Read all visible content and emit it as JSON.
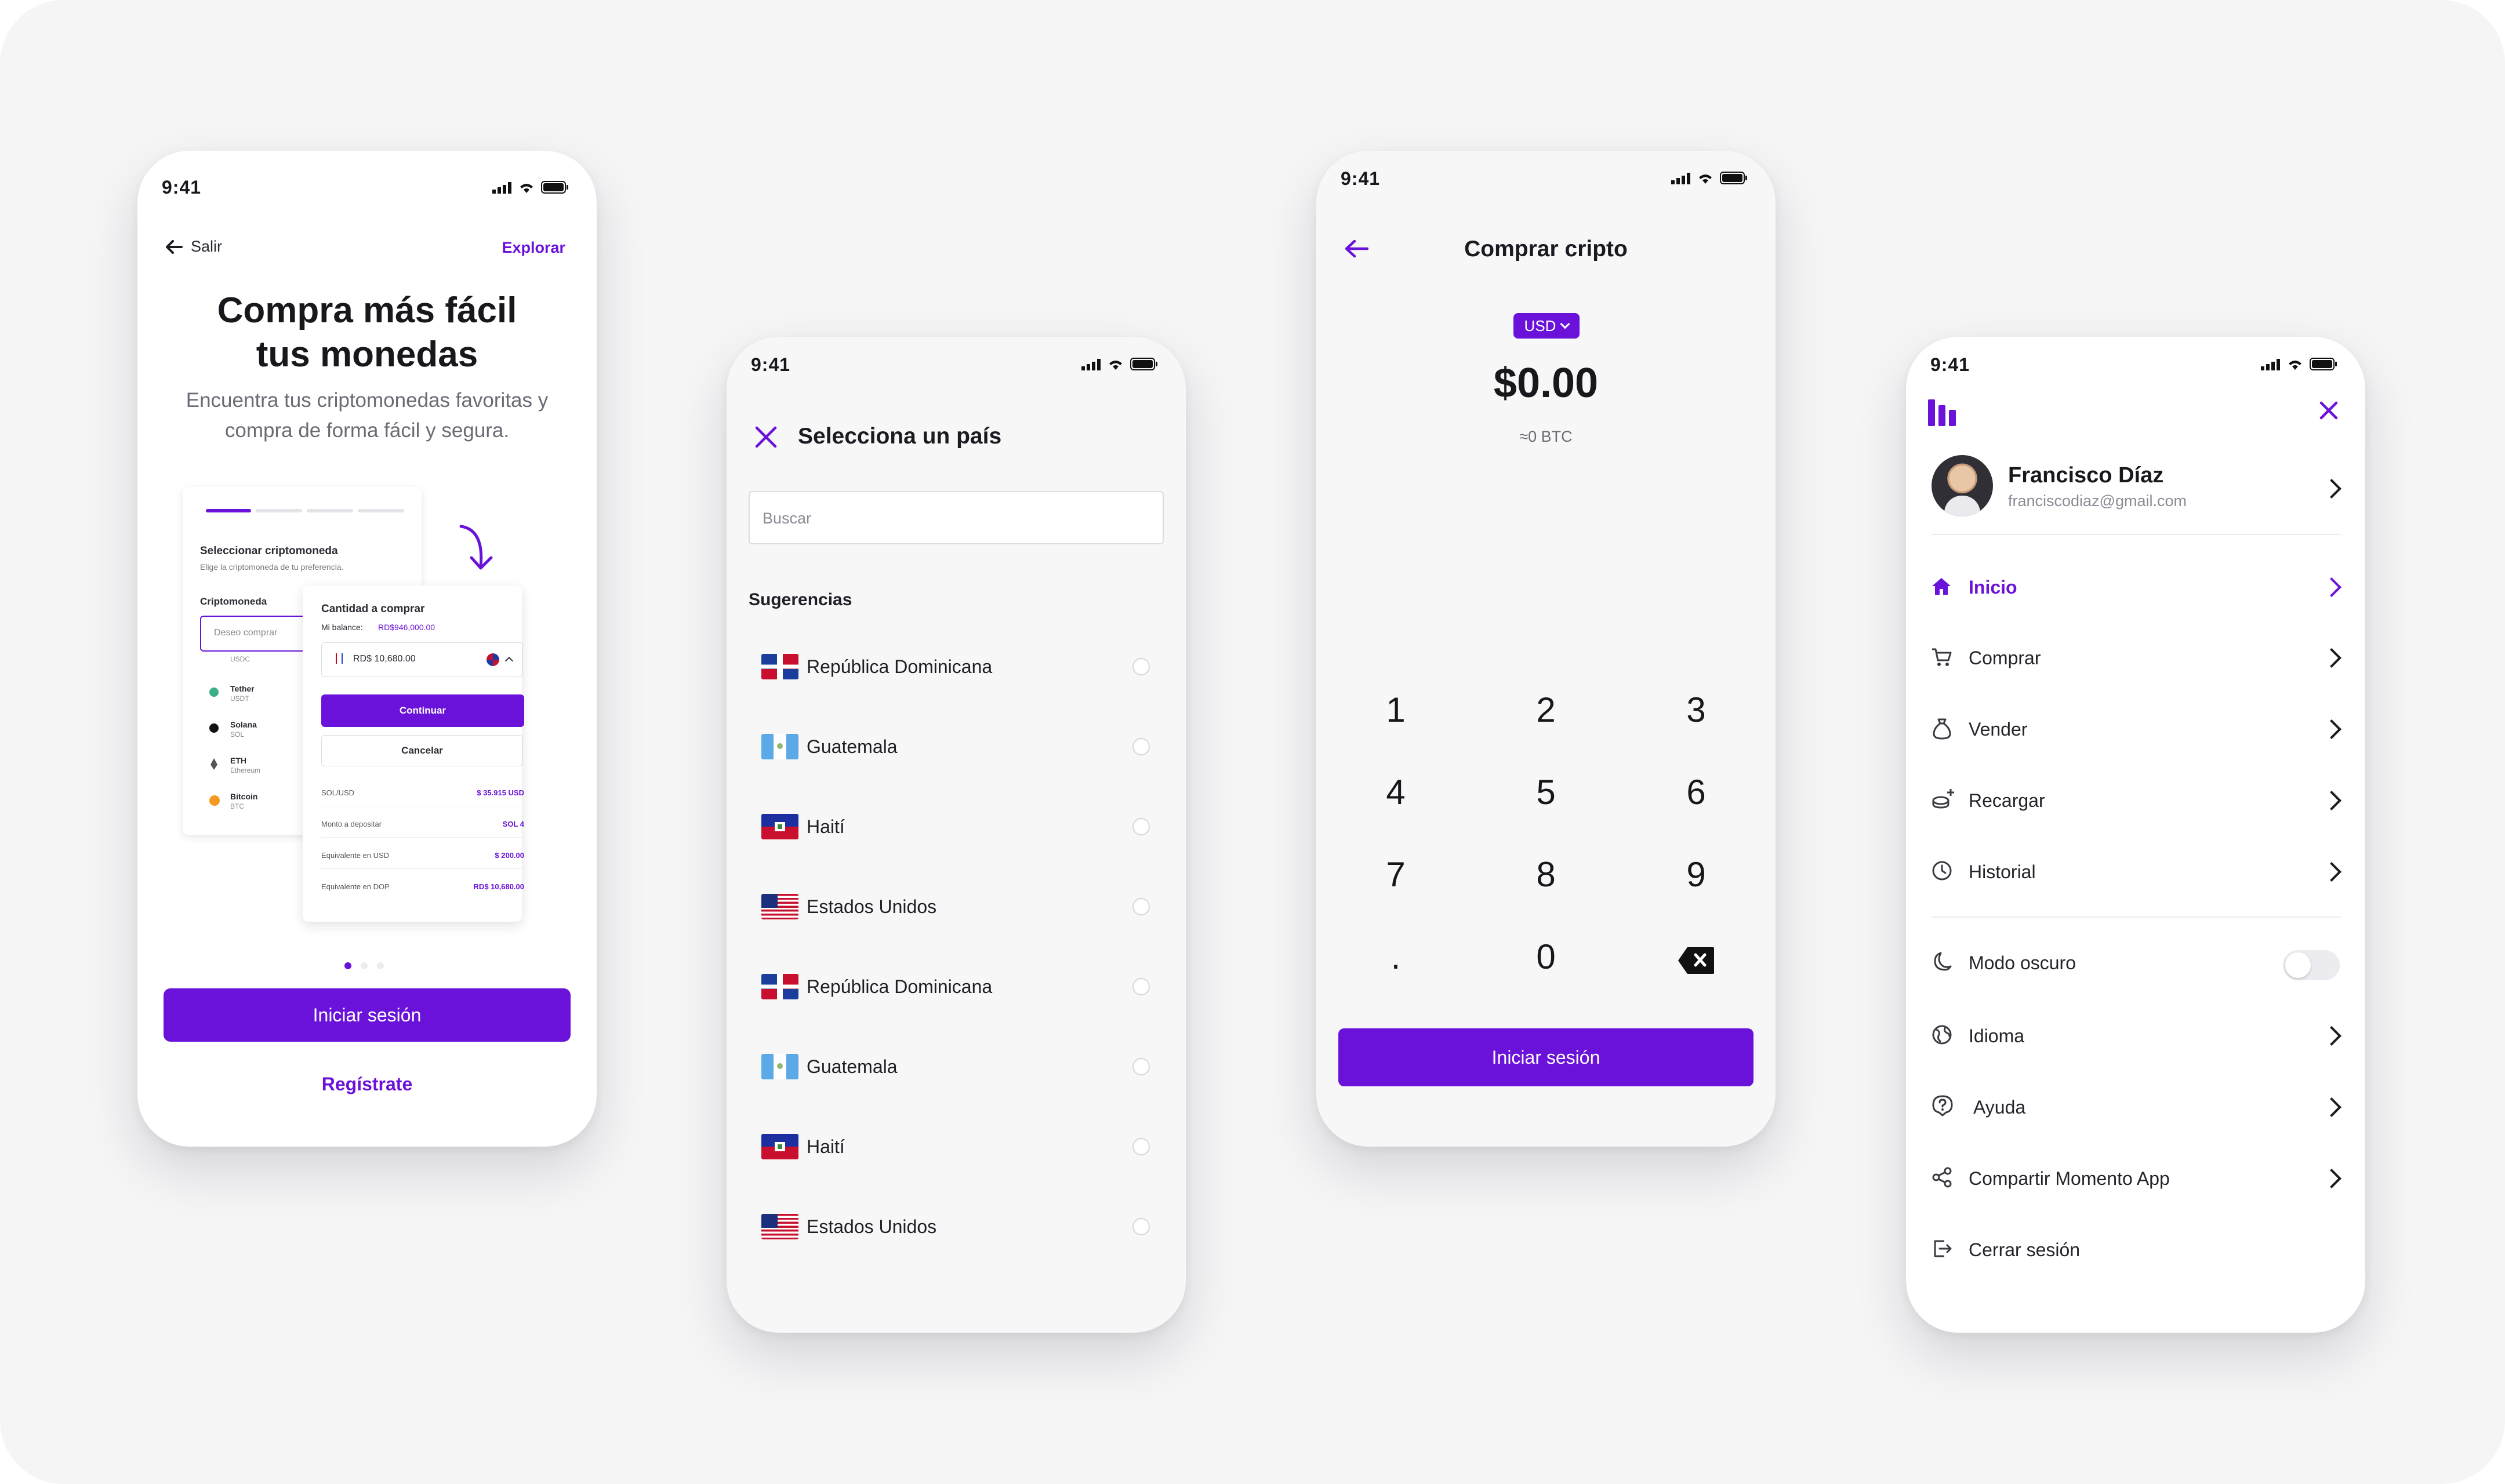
{
  "status_time": "9:41",
  "onboarding": {
    "back_label": "Salir",
    "explore_label": "Explorar",
    "headline_line1": "Compra más fácil",
    "headline_line2": "tus monedas",
    "subtitle_line1": "Encuentra tus criptomonedas favoritas y",
    "subtitle_line2": "compra de forma fácil y segura.",
    "login_button": "Iniciar sesión",
    "register_link": "Regístrate",
    "illustration": {
      "select_title": "Seleccionar criptomoneda",
      "select_subtitle": "Elige la criptomoneda de tu preferencia.",
      "crypto_label": "Criptomoneda",
      "crypto_placeholder": "Deseo comprar",
      "coins": [
        {
          "name": "",
          "ticker": "USDC"
        },
        {
          "name": "Tether",
          "ticker": "USDT"
        },
        {
          "name": "Solana",
          "ticker": "SOL"
        },
        {
          "name": "ETH",
          "ticker": "Ethereum"
        },
        {
          "name": "Bitcoin",
          "ticker": "BTC"
        }
      ],
      "amount_title": "Cantidad a comprar",
      "balance_label": "Mi balance:",
      "balance_value": "RD$946,000.00",
      "amount_value": "RD$ 10,680.00",
      "continue_button": "Continuar",
      "cancel_button": "Cancelar",
      "summary": [
        {
          "label": "SOL/USD",
          "value": "$ 35.915 USD"
        },
        {
          "label": "Monto a depositar",
          "value": "SOL 4"
        },
        {
          "label": "Equivalente en USD",
          "value": "$ 200.00"
        },
        {
          "label": "Equivalente en DOP",
          "value": "RD$ 10,680.00"
        }
      ]
    },
    "pagination": {
      "pages": 3,
      "active": 1
    }
  },
  "country_select": {
    "title": "Selecciona un país",
    "search_placeholder": "Buscar",
    "section_title": "Sugerencias",
    "countries": [
      {
        "name": "República Dominicana",
        "flag": "dominican-republic"
      },
      {
        "name": "Guatemala",
        "flag": "guatemala"
      },
      {
        "name": "Haití",
        "flag": "haiti"
      },
      {
        "name": "Estados Unidos",
        "flag": "united-states"
      },
      {
        "name": "República Dominicana",
        "flag": "dominican-republic"
      },
      {
        "name": "Guatemala",
        "flag": "guatemala"
      },
      {
        "name": "Haití",
        "flag": "haiti"
      },
      {
        "name": "Estados Unidos",
        "flag": "united-states"
      }
    ]
  },
  "buy": {
    "title": "Comprar cripto",
    "currency": "USD",
    "amount": "$0.00",
    "btc_equivalent": "≈0 BTC",
    "keys": [
      "1",
      "2",
      "3",
      "4",
      "5",
      "6",
      "7",
      "8",
      "9",
      ".",
      "0"
    ],
    "backspace_icon": "backspace-icon",
    "login_button": "Iniciar sesión"
  },
  "menu": {
    "user_name": "Francisco Díaz",
    "user_email": "franciscodiaz@gmail.com",
    "items": [
      {
        "label": "Inicio",
        "icon": "home-icon",
        "active": true
      },
      {
        "label": "Comprar",
        "icon": "cart-icon"
      },
      {
        "label": "Vender",
        "icon": "money-bag-icon"
      },
      {
        "label": "Recargar",
        "icon": "coins-plus-icon"
      },
      {
        "label": "Historial",
        "icon": "clock-icon"
      }
    ],
    "dark_mode_label": "Modo oscuro",
    "dark_mode_on": false,
    "items2": [
      {
        "label": "Idioma",
        "icon": "globe-icon"
      },
      {
        "label": "Ayuda",
        "icon": "help-icon"
      },
      {
        "label": "Compartir Momento App",
        "icon": "share-icon"
      }
    ],
    "logout_label": "Cerrar sesión"
  },
  "colors": {
    "accent": "#6a12d9",
    "background": "#f5f5f6",
    "text": "#17171c",
    "muted": "#6b6b75"
  }
}
